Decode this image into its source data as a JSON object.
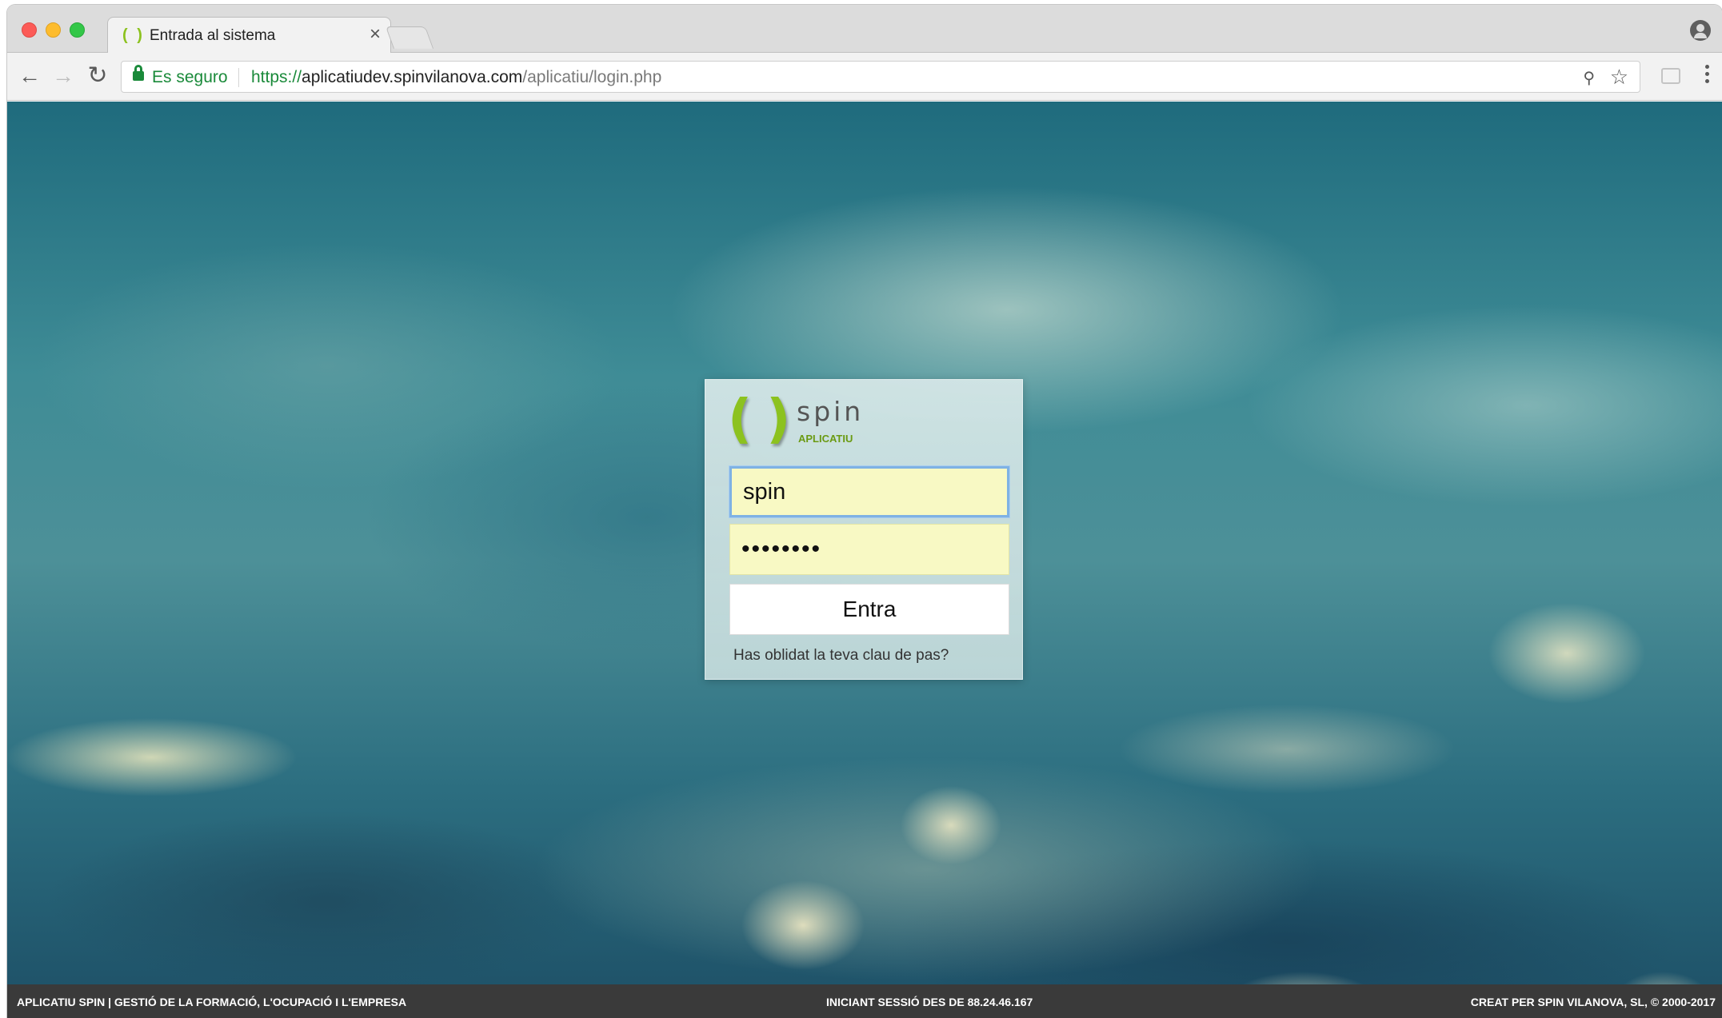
{
  "browser": {
    "tab": {
      "favicon": "( )",
      "title": "Entrada al sistema",
      "close": "×"
    },
    "toolbar": {
      "secure_label": "Es seguro",
      "url_scheme": "https://",
      "url_host": "aplicatiudev.spinvilanova.com",
      "url_path": "/aplicatiu/login.php"
    },
    "icons": {
      "back": "←",
      "forward": "→",
      "reload": "↻",
      "key": "⚲",
      "star": "☆"
    }
  },
  "login": {
    "logo": {
      "brackets": "()",
      "name": "spin",
      "subtitle": "APLICATIU"
    },
    "username_value": "spin",
    "password_value": "••••••••",
    "submit_label": "Entra",
    "forgot_label": "Has oblidat la teva clau de pas?"
  },
  "footer": {
    "left": "APLICATIU SPIN | GESTIÓ DE LA FORMACIÓ, L'OCUPACIÓ I L'EMPRESA",
    "center": "INICIANT SESSIÓ DES DE 88.24.46.167",
    "right": "CREAT PER SPIN VILANOVA, SL, © 2000-2017"
  },
  "colors": {
    "brand_green": "#8cc21f",
    "secure_green": "#1a8a3a",
    "input_fill": "#f8f9c4",
    "footer_bg": "#3a3a3a"
  }
}
